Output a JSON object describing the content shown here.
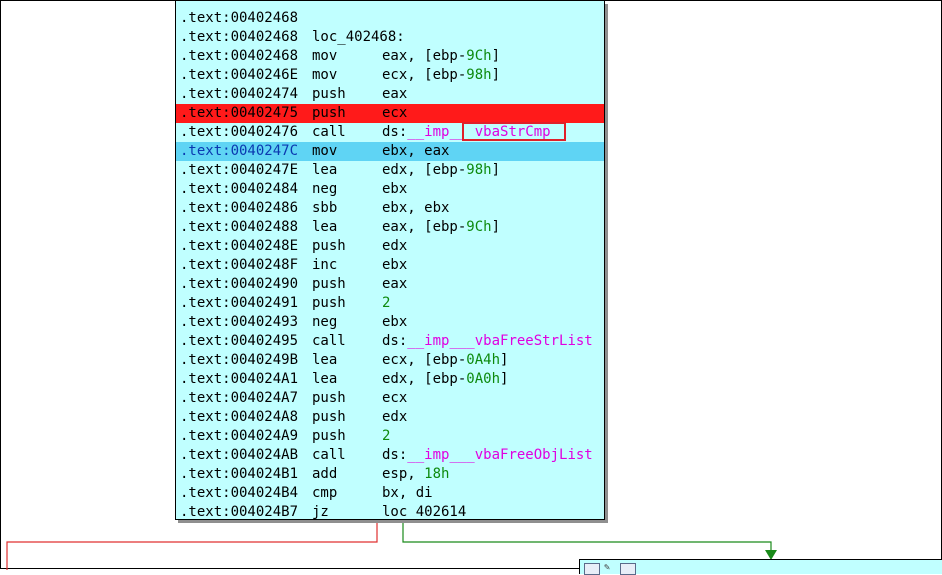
{
  "disassembly": {
    "lines": [
      {
        "addr": ".text:00402468",
        "mnemonic": "",
        "label": "",
        "operands": []
      },
      {
        "addr": ".text:00402468",
        "mnemonic": "",
        "label": "loc_402468:",
        "operands": []
      },
      {
        "addr": ".text:00402468",
        "mnemonic": "mov",
        "label": "",
        "operands": [
          {
            "t": "eax, [ebp-",
            "c": "plain"
          },
          {
            "t": "9Ch",
            "c": "num"
          },
          {
            "t": "]",
            "c": "plain"
          }
        ]
      },
      {
        "addr": ".text:0040246E",
        "mnemonic": "mov",
        "label": "",
        "operands": [
          {
            "t": "ecx, [ebp-",
            "c": "plain"
          },
          {
            "t": "98h",
            "c": "num"
          },
          {
            "t": "]",
            "c": "plain"
          }
        ]
      },
      {
        "addr": ".text:00402474",
        "mnemonic": "push",
        "label": "",
        "operands": [
          {
            "t": "eax",
            "c": "plain"
          }
        ]
      },
      {
        "addr": ".text:00402475",
        "mnemonic": "push",
        "label": "",
        "operands": [
          {
            "t": "ecx",
            "c": "plain"
          }
        ],
        "state": "breakpoint"
      },
      {
        "addr": ".text:00402476",
        "mnemonic": "call",
        "label": "",
        "operands": [
          {
            "t": "ds:",
            "c": "plain"
          },
          {
            "t": "__imp___vbaStrCmp",
            "c": "imp"
          }
        ],
        "boxed": true
      },
      {
        "addr": ".text:0040247C",
        "mnemonic": "mov",
        "label": "",
        "operands": [
          {
            "t": "ebx, eax",
            "c": "plain"
          }
        ],
        "state": "current"
      },
      {
        "addr": ".text:0040247E",
        "mnemonic": "lea",
        "label": "",
        "operands": [
          {
            "t": "edx, [ebp-",
            "c": "plain"
          },
          {
            "t": "98h",
            "c": "num"
          },
          {
            "t": "]",
            "c": "plain"
          }
        ]
      },
      {
        "addr": ".text:00402484",
        "mnemonic": "neg",
        "label": "",
        "operands": [
          {
            "t": "ebx",
            "c": "plain"
          }
        ]
      },
      {
        "addr": ".text:00402486",
        "mnemonic": "sbb",
        "label": "",
        "operands": [
          {
            "t": "ebx, ebx",
            "c": "plain"
          }
        ]
      },
      {
        "addr": ".text:00402488",
        "mnemonic": "lea",
        "label": "",
        "operands": [
          {
            "t": "eax, [ebp-",
            "c": "plain"
          },
          {
            "t": "9Ch",
            "c": "num"
          },
          {
            "t": "]",
            "c": "plain"
          }
        ]
      },
      {
        "addr": ".text:0040248E",
        "mnemonic": "push",
        "label": "",
        "operands": [
          {
            "t": "edx",
            "c": "plain"
          }
        ]
      },
      {
        "addr": ".text:0040248F",
        "mnemonic": "inc",
        "label": "",
        "operands": [
          {
            "t": "ebx",
            "c": "plain"
          }
        ]
      },
      {
        "addr": ".text:00402490",
        "mnemonic": "push",
        "label": "",
        "operands": [
          {
            "t": "eax",
            "c": "plain"
          }
        ]
      },
      {
        "addr": ".text:00402491",
        "mnemonic": "push",
        "label": "",
        "operands": [
          {
            "t": "2",
            "c": "num"
          }
        ]
      },
      {
        "addr": ".text:00402493",
        "mnemonic": "neg",
        "label": "",
        "operands": [
          {
            "t": "ebx",
            "c": "plain"
          }
        ]
      },
      {
        "addr": ".text:00402495",
        "mnemonic": "call",
        "label": "",
        "operands": [
          {
            "t": "ds:",
            "c": "plain"
          },
          {
            "t": "__imp___vbaFreeStrList",
            "c": "imp"
          }
        ]
      },
      {
        "addr": ".text:0040249B",
        "mnemonic": "lea",
        "label": "",
        "operands": [
          {
            "t": "ecx, [ebp-",
            "c": "plain"
          },
          {
            "t": "0A4h",
            "c": "num"
          },
          {
            "t": "]",
            "c": "plain"
          }
        ]
      },
      {
        "addr": ".text:004024A1",
        "mnemonic": "lea",
        "label": "",
        "operands": [
          {
            "t": "edx, [ebp-",
            "c": "plain"
          },
          {
            "t": "0A0h",
            "c": "num"
          },
          {
            "t": "]",
            "c": "plain"
          }
        ]
      },
      {
        "addr": ".text:004024A7",
        "mnemonic": "push",
        "label": "",
        "operands": [
          {
            "t": "ecx",
            "c": "plain"
          }
        ]
      },
      {
        "addr": ".text:004024A8",
        "mnemonic": "push",
        "label": "",
        "operands": [
          {
            "t": "edx",
            "c": "plain"
          }
        ]
      },
      {
        "addr": ".text:004024A9",
        "mnemonic": "push",
        "label": "",
        "operands": [
          {
            "t": "2",
            "c": "num"
          }
        ]
      },
      {
        "addr": ".text:004024AB",
        "mnemonic": "call",
        "label": "",
        "operands": [
          {
            "t": "ds:",
            "c": "plain"
          },
          {
            "t": "__imp___vbaFreeObjList",
            "c": "imp"
          }
        ]
      },
      {
        "addr": ".text:004024B1",
        "mnemonic": "add",
        "label": "",
        "operands": [
          {
            "t": "esp, ",
            "c": "plain"
          },
          {
            "t": "18h",
            "c": "num"
          }
        ]
      },
      {
        "addr": ".text:004024B4",
        "mnemonic": "cmp",
        "label": "",
        "operands": [
          {
            "t": "bx, di",
            "c": "plain"
          }
        ]
      },
      {
        "addr": ".text:004024B7",
        "mnemonic": "jz",
        "label": "",
        "operands": [
          {
            "t": "loc_402614",
            "c": "plain"
          }
        ]
      }
    ]
  },
  "colors": {
    "node_bg": "#c0ffff",
    "breakpoint": "#ff1a1a",
    "current_line": "#5fd4f4",
    "number": "#0d8a0d",
    "import": "#e000e0",
    "false_edge": "#e03030",
    "true_edge": "#1a8a1a"
  },
  "edges": {
    "false_branch": "red-edge",
    "true_branch": "green-edge"
  }
}
